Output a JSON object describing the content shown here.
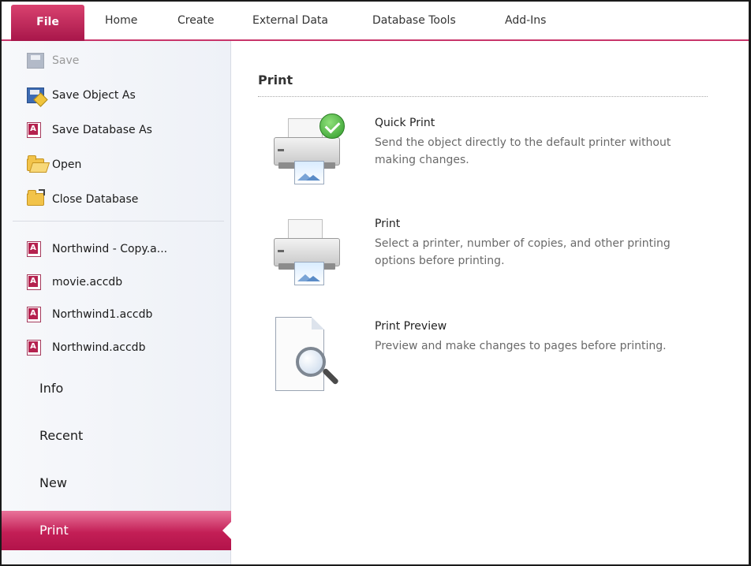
{
  "ribbon": {
    "tabs": [
      {
        "label": "File"
      },
      {
        "label": "Home"
      },
      {
        "label": "Create"
      },
      {
        "label": "External Data"
      },
      {
        "label": "Database Tools"
      },
      {
        "label": "Add-Ins"
      }
    ],
    "active_color": "#c31f56"
  },
  "backstage": {
    "commands": [
      {
        "label": "Save",
        "icon": "save-icon",
        "enabled": false
      },
      {
        "label": "Save Object As",
        "icon": "save-object-as-icon",
        "enabled": true
      },
      {
        "label": "Save Database As",
        "icon": "access-database-icon",
        "enabled": true
      },
      {
        "label": "Open",
        "icon": "open-folder-icon",
        "enabled": true
      },
      {
        "label": "Close Database",
        "icon": "close-folder-icon",
        "enabled": true
      }
    ],
    "recent_files": [
      {
        "label": "Northwind - Copy.a...",
        "icon": "access-database-icon"
      },
      {
        "label": "movie.accdb",
        "icon": "access-database-icon"
      },
      {
        "label": "Northwind1.accdb",
        "icon": "access-database-icon"
      },
      {
        "label": "Northwind.accdb",
        "icon": "access-database-icon"
      }
    ],
    "nav": [
      {
        "label": "Info",
        "active": false
      },
      {
        "label": "Recent",
        "active": false
      },
      {
        "label": "New",
        "active": false
      },
      {
        "label": "Print",
        "active": true
      }
    ]
  },
  "print_pane": {
    "title": "Print",
    "options": [
      {
        "title": "Quick Print",
        "description": "Send the object directly to the default printer without making changes.",
        "icon": "quick-print-icon"
      },
      {
        "title": "Print",
        "description": "Select a printer, number of copies, and other printing options before printing.",
        "icon": "printer-icon"
      },
      {
        "title": "Print Preview",
        "description": "Preview and make changes to pages before printing.",
        "icon": "print-preview-icon"
      }
    ]
  }
}
